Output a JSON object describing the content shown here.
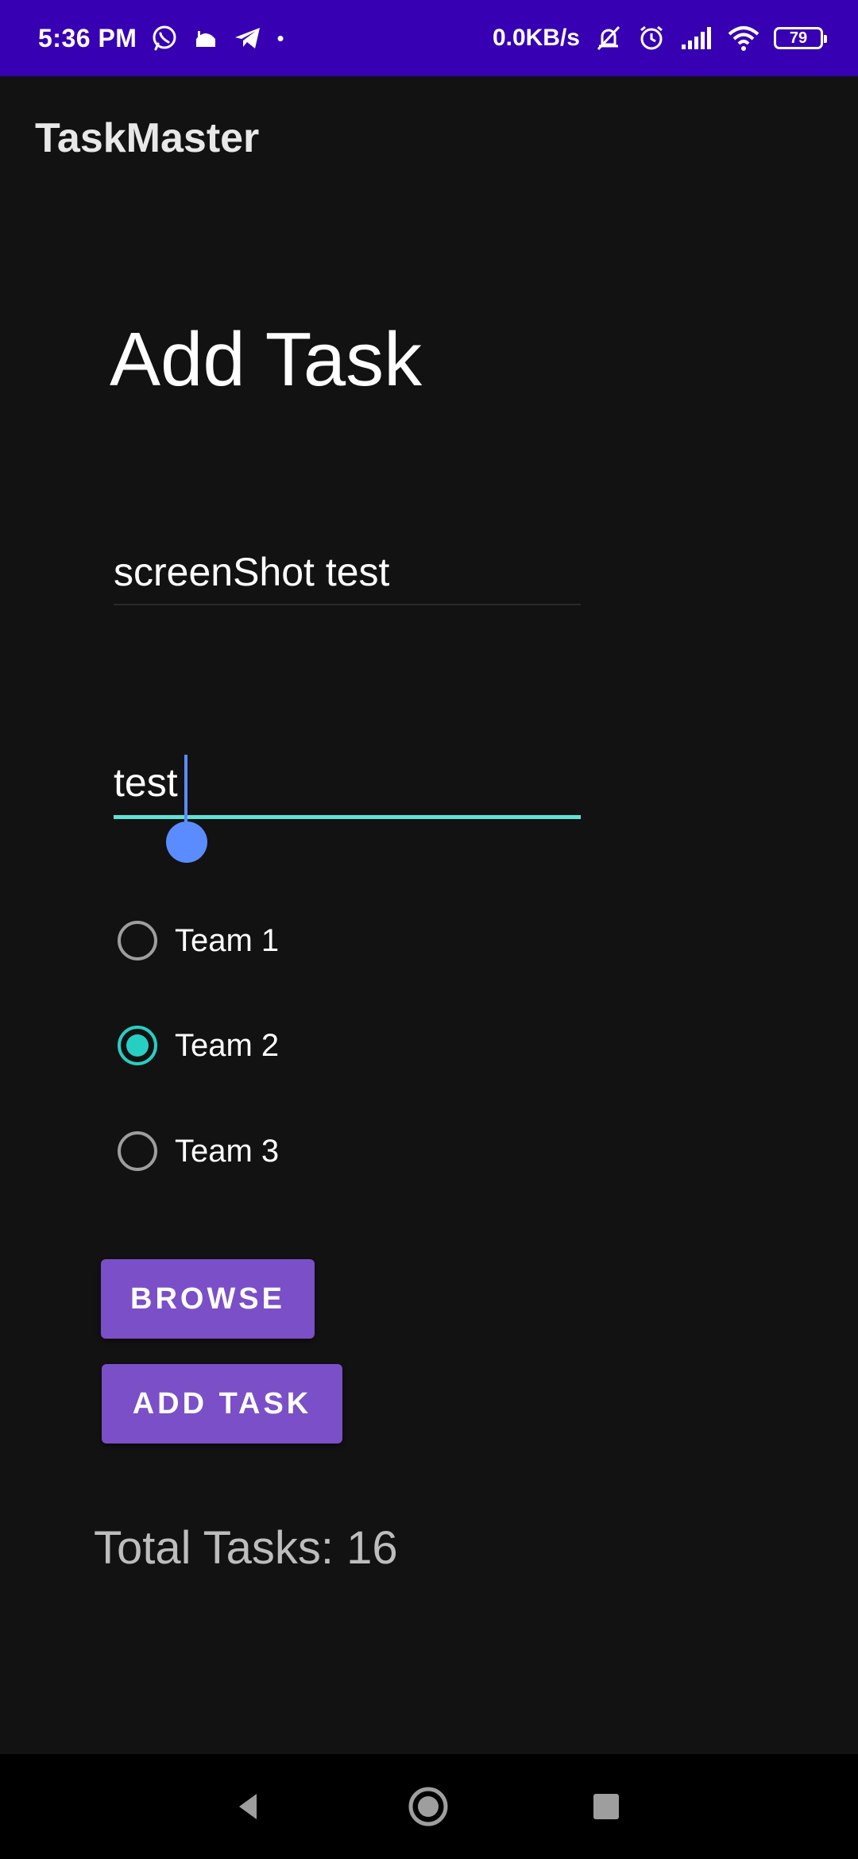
{
  "status_bar": {
    "time": "5:36 PM",
    "net_speed": "0.0KB/s",
    "battery": "79",
    "left_icons": [
      "whatsapp-icon",
      "mosque-notification-icon",
      "telegram-icon",
      "more-dot-icon"
    ],
    "right_icons": [
      "muted-bell-icon",
      "alarm-icon",
      "signal-icon",
      "wifi-icon",
      "battery-icon"
    ]
  },
  "app_bar": {
    "title": "TaskMaster"
  },
  "main": {
    "page_title": "Add Task",
    "task_title": "screenShot test",
    "task_description": "test",
    "teams": [
      {
        "label": "Team 1",
        "checked": false
      },
      {
        "label": "Team 2",
        "checked": true
      },
      {
        "label": "Team 3",
        "checked": false
      }
    ],
    "browse_label": "BROWSE",
    "add_task_label": "ADD TASK",
    "total_tasks": "Total Tasks: 16"
  },
  "nav_bar": {
    "items": [
      "back-icon",
      "home-icon",
      "recents-icon"
    ]
  },
  "colors": {
    "status_bar": "#3700b3",
    "background": "#121212",
    "accent": "#27cfc2",
    "button": "#7b4fc7",
    "caret": "#5b8cff"
  }
}
